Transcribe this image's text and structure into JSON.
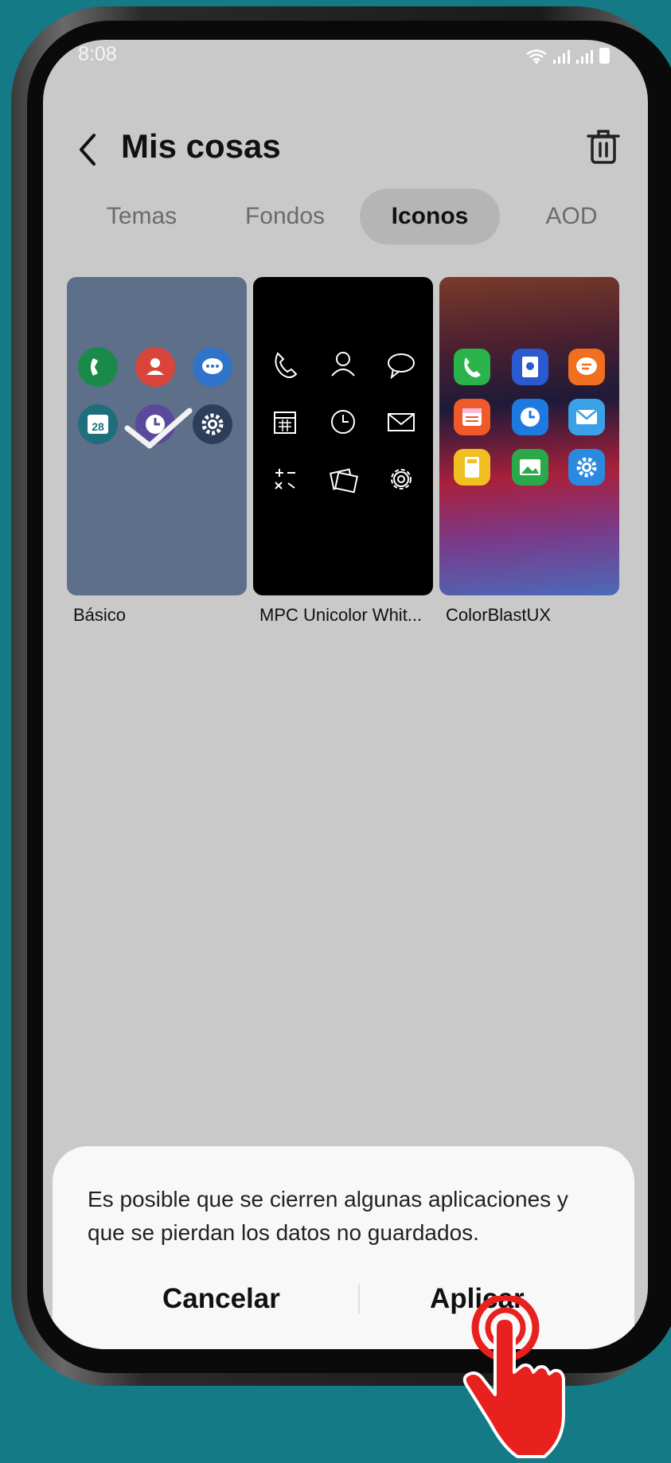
{
  "status_bar": {
    "time": "8:08"
  },
  "header": {
    "title": "Mis cosas"
  },
  "tabs": [
    {
      "label": "Temas"
    },
    {
      "label": "Fondos"
    },
    {
      "label": "Iconos"
    },
    {
      "label": "AOD"
    }
  ],
  "active_tab": "Iconos",
  "icon_packs": [
    {
      "name": "Básico",
      "selected": true,
      "calendar_day": "28"
    },
    {
      "name": "MPC Unicolor Whit...",
      "selected": false
    },
    {
      "name": "ColorBlastUX",
      "selected": false
    }
  ],
  "dialog": {
    "message": "Es posible que se cierren algunas aplicaciones y que se pierdan los datos no guardados.",
    "cancel_label": "Cancelar",
    "apply_label": "Aplicar"
  },
  "colors": {
    "background": "#137a86",
    "screen": "#c9c9c9",
    "accent_hand": "#e8201e"
  }
}
